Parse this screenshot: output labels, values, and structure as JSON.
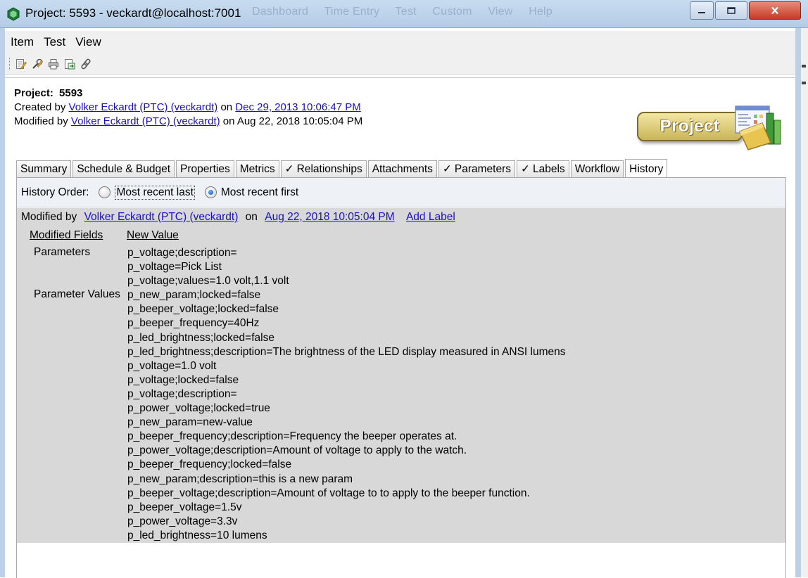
{
  "window": {
    "title": "Project: 5593 - veckardt@localhost:7001",
    "ghost_menu": [
      "Dashboard",
      "Time Entry",
      "Test",
      "Custom",
      "View",
      "Help"
    ]
  },
  "menubar": {
    "items": [
      "Item",
      "Test",
      "View"
    ]
  },
  "toolbar": {
    "buttons": [
      "edit-icon",
      "edit-properties-icon",
      "print-icon",
      "export-icon",
      "link-icon"
    ]
  },
  "header": {
    "label": "Project:",
    "id": "5593",
    "created_prefix": "Created by",
    "created_by": "Volker Eckardt (PTC) (veckardt)",
    "on": "on",
    "created_date": "Dec 29, 2013 10:06:47 PM",
    "modified_prefix": "Modified by",
    "modified_by": "Volker Eckardt (PTC) (veckardt)",
    "modified_date": "Aug 22, 2018 10:05:04 PM"
  },
  "badge": {
    "label": "Project"
  },
  "tabs": [
    {
      "label": "Summary",
      "checked": false
    },
    {
      "label": "Schedule & Budget",
      "checked": false
    },
    {
      "label": "Properties",
      "checked": false
    },
    {
      "label": "Metrics",
      "checked": false
    },
    {
      "label": "Relationships",
      "checked": true
    },
    {
      "label": "Attachments",
      "checked": false
    },
    {
      "label": "Parameters",
      "checked": true
    },
    {
      "label": "Labels",
      "checked": true
    },
    {
      "label": "Workflow",
      "checked": false
    },
    {
      "label": "History",
      "checked": false,
      "active": true
    }
  ],
  "history": {
    "order_label": "History Order:",
    "option_last": "Most recent last",
    "option_first": "Most recent first",
    "selected": "Most recent first",
    "entry": {
      "modified_by_label": "Modified by",
      "user": "Volker Eckardt (PTC) (veckardt)",
      "on": "on",
      "date": "Aug 22, 2018 10:05:04 PM",
      "add_label": "Add Label"
    },
    "col_fields": "Modified Fields",
    "col_value": "New Value",
    "groups": [
      {
        "field": "Parameters",
        "values": [
          "p_voltage;description=",
          "p_voltage=Pick List",
          "p_voltage;values=1.0 volt,1.1 volt"
        ]
      },
      {
        "field": "Parameter Values",
        "values": [
          "p_new_param;locked=false",
          "p_beeper_voltage;locked=false",
          "p_beeper_frequency=40Hz",
          "p_led_brightness;locked=false",
          "p_led_brightness;description=The brightness of the LED display measured in ANSI lumens",
          "p_voltage=1.0 volt",
          "p_voltage;locked=false",
          "p_voltage;description=",
          "p_power_voltage;locked=true",
          "p_new_param=new-value",
          "p_beeper_frequency;description=Frequency the beeper operates at.",
          "p_power_voltage;description=Amount of voltage to apply to the watch.",
          "p_beeper_frequency;locked=false",
          "p_new_param;description=this is a new param",
          "p_beeper_voltage;description=Amount of voltage to to apply to the beeper function.",
          "p_beeper_voltage=1.5v",
          "p_power_voltage=3.3v",
          "p_led_brightness=10 lumens"
        ]
      }
    ]
  }
}
